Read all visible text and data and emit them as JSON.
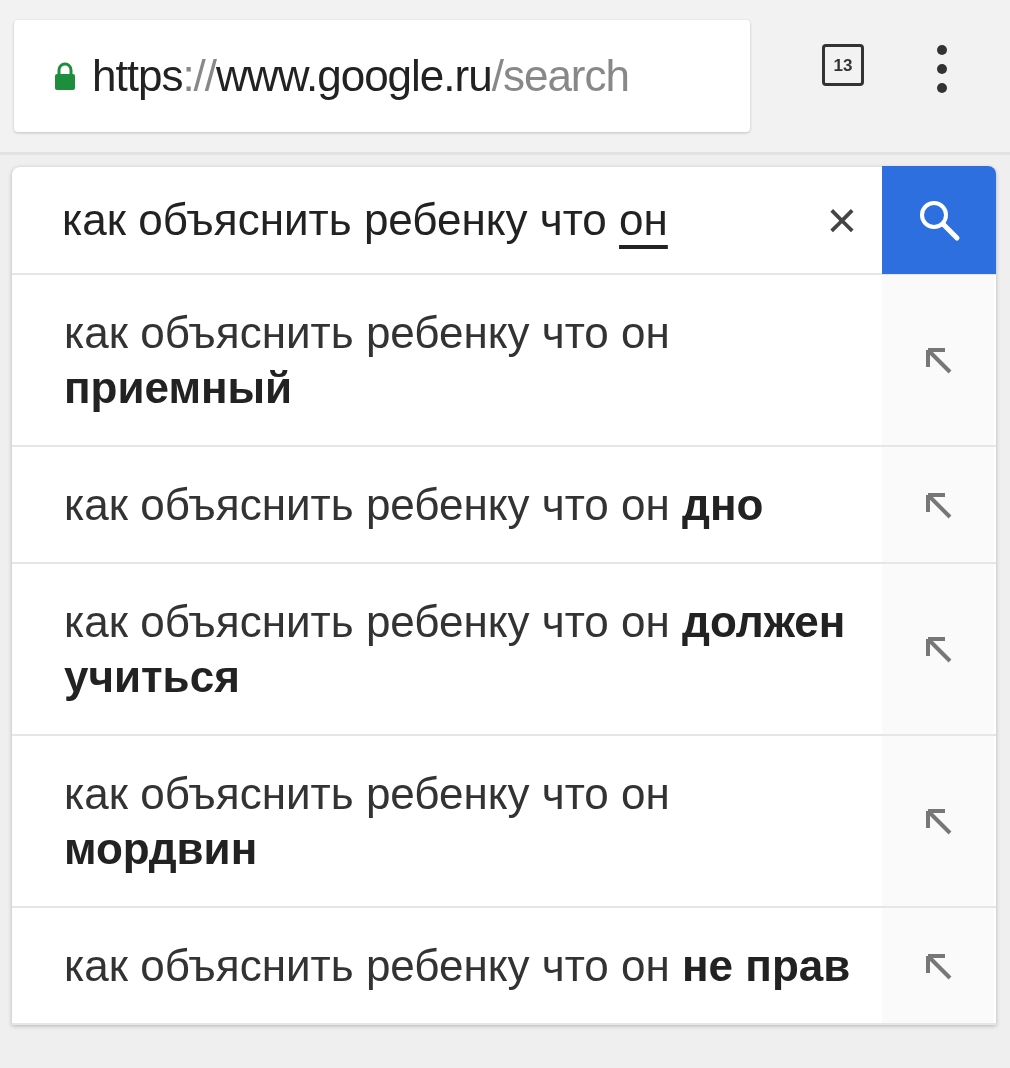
{
  "address_bar": {
    "secure": true,
    "url_parts": [
      {
        "text": "https",
        "dim": false
      },
      {
        "text": "://",
        "dim": true
      },
      {
        "text": "www.google.ru",
        "dim": false
      },
      {
        "text": "/search",
        "dim": true
      }
    ],
    "tab_count": "13"
  },
  "search": {
    "value": "как объяснить ребенку что ",
    "composing": "он",
    "clear": "×"
  },
  "suggestions": [
    {
      "text": "как объяснить ребенку что он **приемный**"
    },
    {
      "text": "как объяснить ребенку что он **дно**"
    },
    {
      "text": "как объяснить ребенку что он **должен учиться**"
    },
    {
      "text": "как объяснить ребенку что он **мордвин**"
    },
    {
      "text": "как объяснить ребенку что он **не** **прав**"
    }
  ]
}
